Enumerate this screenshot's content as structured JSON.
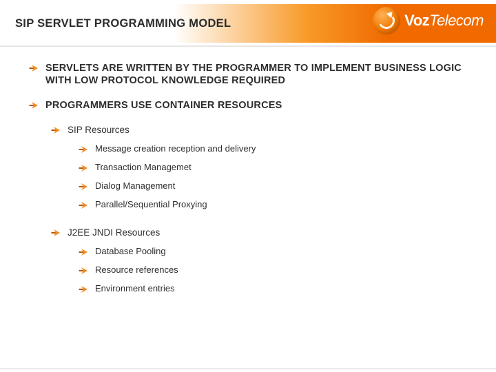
{
  "slide": {
    "title": "SIP SERVLET PROGRAMMING MODEL",
    "logo": {
      "brand_bold": "Voz",
      "brand_italic": "Telecom"
    }
  },
  "bullets": {
    "p1": "SERVLETS ARE WRITTEN BY THE PROGRAMMER TO IMPLEMENT BUSINESS LOGIC WITH LOW PROTOCOL KNOWLEDGE REQUIRED",
    "p2": "PROGRAMMERS USE CONTAINER RESOURCES",
    "sip": {
      "heading": "SIP Resources",
      "items": [
        "Message creation reception and delivery",
        "Transaction Managemet",
        "Dialog Management",
        "Parallel/Sequential Proxying"
      ]
    },
    "j2ee": {
      "heading": "J2EE JNDI Resources",
      "items": [
        "Database Pooling",
        "Resource references",
        "Environment entries"
      ]
    }
  },
  "colors": {
    "accent": "#f07800"
  }
}
